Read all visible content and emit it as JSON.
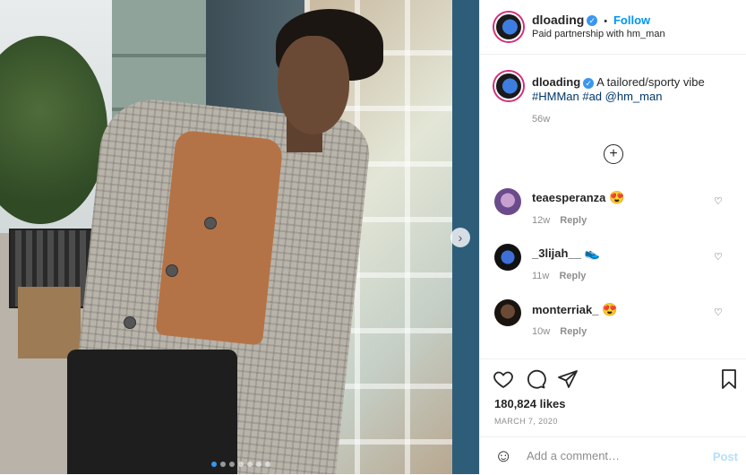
{
  "header": {
    "username": "dloading",
    "separator": "•",
    "follow_label": "Follow",
    "subtitle": "Paid partnership with hm_man"
  },
  "caption": {
    "username": "dloading",
    "text": "A tailored/sporty vibe",
    "tags": "#HMMan #ad @hm_man",
    "age": "56w"
  },
  "comments": [
    {
      "username": "teaesperanza",
      "emoji": "😍",
      "age": "12w",
      "reply_label": "Reply"
    },
    {
      "username": "_3lijah__",
      "emoji": "👟",
      "age": "11w",
      "reply_label": "Reply"
    },
    {
      "username": "monterriak_",
      "emoji": "😍",
      "age": "10w",
      "reply_label": "Reply"
    }
  ],
  "actions": {
    "likes": "180,824 likes",
    "date": "MARCH 7, 2020"
  },
  "add_comment": {
    "placeholder": "Add a comment…",
    "post_label": "Post"
  },
  "carousel": {
    "slide_count": 7,
    "active_index": 0
  },
  "colors": {
    "accent": "#0095f6",
    "verified": "#3897f0",
    "post_disabled": "#b2dffc",
    "story_ring": "#d62976",
    "like_heart": "#ed4956"
  }
}
